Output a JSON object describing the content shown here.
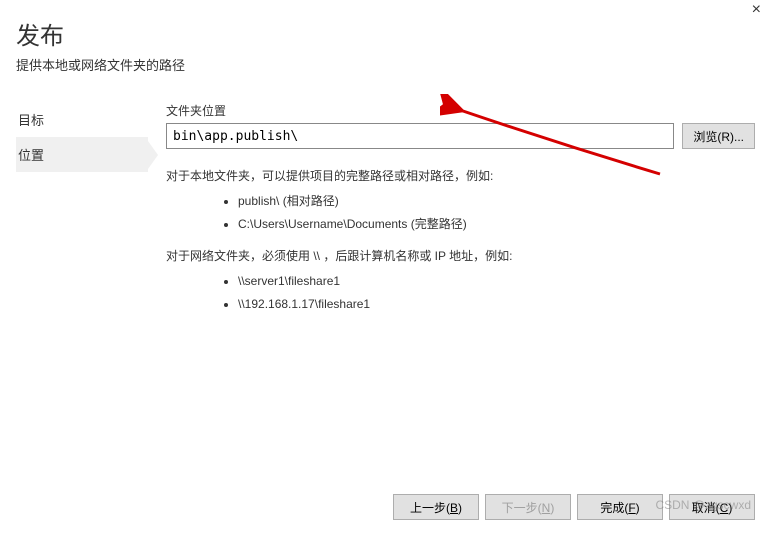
{
  "header": {
    "title": "发布",
    "subtitle": "提供本地或网络文件夹的路径"
  },
  "sidebar": {
    "items": [
      {
        "label": "目标",
        "active": false
      },
      {
        "label": "位置",
        "active": true
      }
    ]
  },
  "main": {
    "folder_label": "文件夹位置",
    "folder_value": "bin\\app.publish\\",
    "browse_label": "浏览(R)...",
    "help_local_intro": "对于本地文件夹，可以提供项目的完整路径或相对路径，例如:",
    "help_local_items": [
      "publish\\ (相对路径)",
      "C:\\Users\\Username\\Documents (完整路径)"
    ],
    "help_network_intro": "对于网络文件夹，必须使用 \\\\ ，后跟计算机名称或 IP 地址，例如:",
    "help_network_items": [
      "\\\\server1\\fileshare1",
      "\\\\192.168.1.17\\fileshare1"
    ]
  },
  "footer": {
    "prev": "上一步(B)",
    "next": "下一步(N)",
    "finish": "完成(F)",
    "cancel": "取消(C)"
  },
  "close_label": "×",
  "watermark": "CSDN @zgscwxd"
}
